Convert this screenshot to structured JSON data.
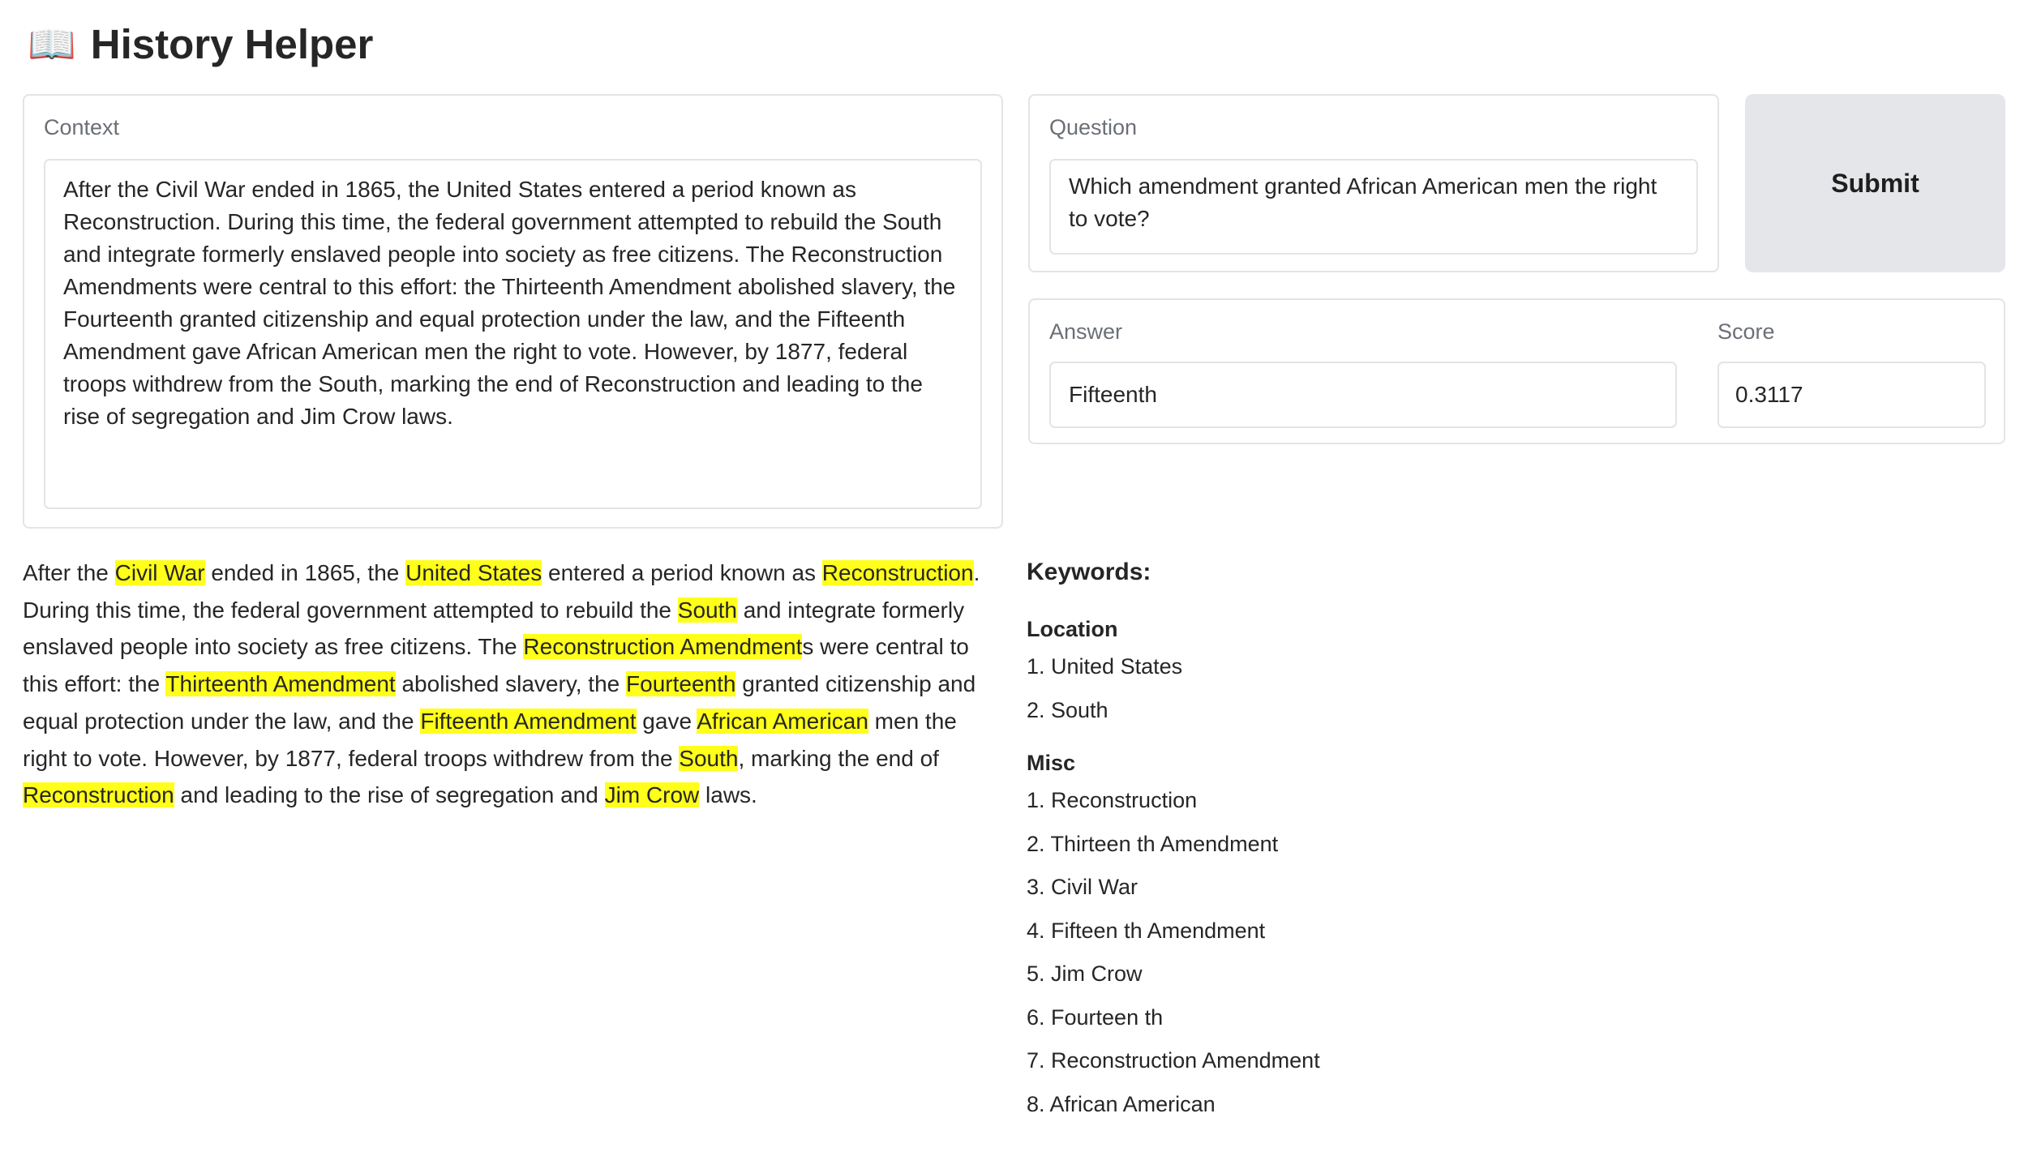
{
  "header": {
    "icon": "📖",
    "icon_name": "open-book-icon",
    "title": "History Helper"
  },
  "context": {
    "label": "Context",
    "value": "After the Civil War ended in 1865, the United States entered a period known as Reconstruction. During this time, the federal government attempted to rebuild the South and integrate formerly enslaved people into society as free citizens. The Reconstruction Amendments were central to this effort: the Thirteenth Amendment abolished slavery, the Fourteenth granted citizenship and equal protection under the law, and the Fifteenth Amendment gave African American men the right to vote. However, by 1877, federal troops withdrew from the South, marking the end of Reconstruction and leading to the rise of segregation and Jim Crow laws."
  },
  "question": {
    "label": "Question",
    "value": "Which amendment granted African American men the right to vote?"
  },
  "submit": {
    "label": "Submit"
  },
  "answer": {
    "label": "Answer",
    "value": "Fifteenth"
  },
  "score": {
    "label": "Score",
    "value": "0.3117"
  },
  "highlighted": {
    "highlight_color": "#ffff1a",
    "segments": [
      {
        "text": "After the ",
        "hl": false
      },
      {
        "text": "Civil War",
        "hl": true
      },
      {
        "text": " ended in 1865, the ",
        "hl": false
      },
      {
        "text": "United States",
        "hl": true
      },
      {
        "text": " entered a period known as ",
        "hl": false
      },
      {
        "text": "Reconstruction",
        "hl": true
      },
      {
        "text": ". During this time, the federal government attempted to rebuild the ",
        "hl": false
      },
      {
        "text": "South",
        "hl": true
      },
      {
        "text": " and integrate formerly enslaved people into society as free citizens. The ",
        "hl": false
      },
      {
        "text": "Reconstruction Amendment",
        "hl": true
      },
      {
        "text": "s were central to this effort: the ",
        "hl": false
      },
      {
        "text": "Thirteenth Amendment",
        "hl": true
      },
      {
        "text": " abolished slavery, the ",
        "hl": false
      },
      {
        "text": "Fourteenth",
        "hl": true
      },
      {
        "text": " granted citizenship and equal protection under the law, and the ",
        "hl": false
      },
      {
        "text": "Fifteenth Amendment",
        "hl": true
      },
      {
        "text": " gave ",
        "hl": false
      },
      {
        "text": "African American",
        "hl": true
      },
      {
        "text": " men the right to vote. However, by 1877, federal troops withdrew from the ",
        "hl": false
      },
      {
        "text": "South",
        "hl": true
      },
      {
        "text": ", marking the end of ",
        "hl": false
      },
      {
        "text": "Reconstruction",
        "hl": true
      },
      {
        "text": " and leading to the rise of segregation and ",
        "hl": false
      },
      {
        "text": "Jim Crow",
        "hl": true
      },
      {
        "text": " laws.",
        "hl": false
      }
    ]
  },
  "keywords": {
    "title": "Keywords:",
    "location": {
      "heading": "Location",
      "items": [
        "1. United States",
        "2. South"
      ]
    },
    "misc": {
      "heading": "Misc",
      "items": [
        "1. Reconstruction",
        "2. Thirteen th Amendment",
        "3. Civil War",
        "4. Fifteen th Amendment",
        "5. Jim Crow",
        "6. Fourteen th",
        "7. Reconstruction Amendment",
        "8. African American"
      ]
    }
  }
}
